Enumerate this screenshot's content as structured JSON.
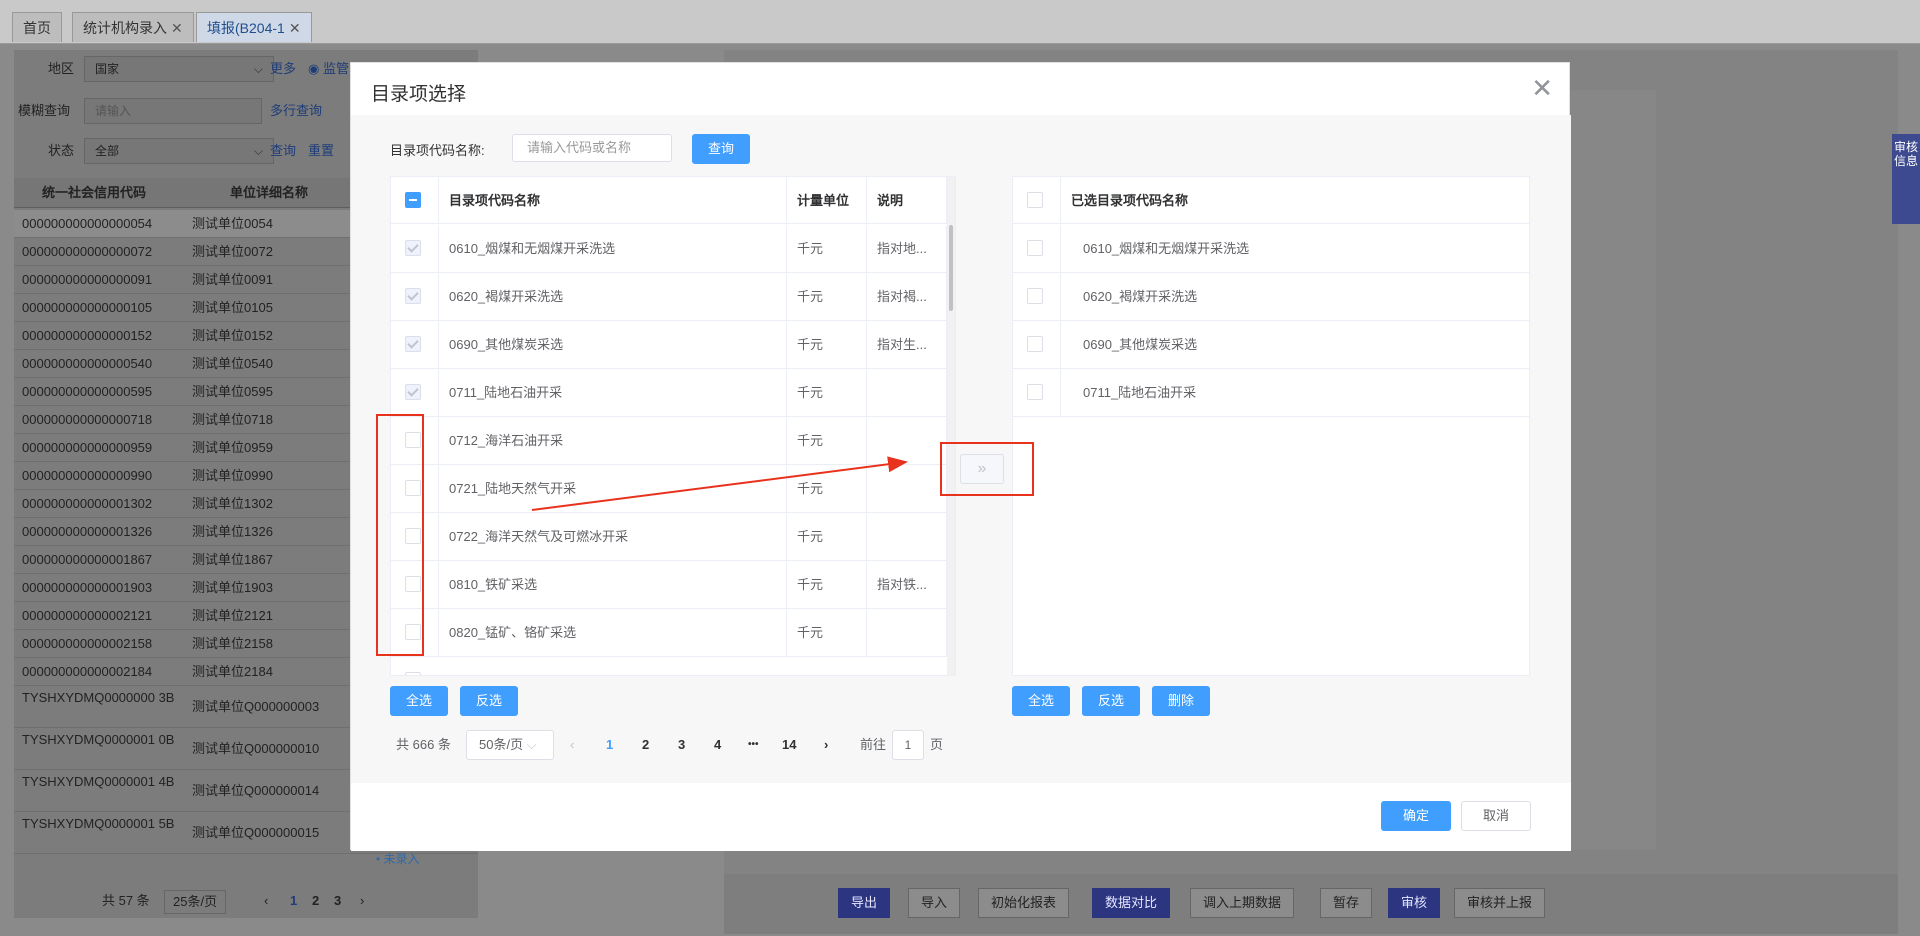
{
  "tabs": [
    {
      "label": "首页",
      "closable": false
    },
    {
      "label": "统计机构录入",
      "closable": true
    },
    {
      "label": "填报(B204-1",
      "closable": true,
      "active": true
    }
  ],
  "left_panel": {
    "region_label": "地区",
    "region_value": "国家",
    "more_label": "更多",
    "supervise_label": "监管",
    "fuzzy_label": "模糊查询",
    "fuzzy_placeholder": "请输入",
    "multiline_query": "多行查询",
    "status_label": "状态",
    "status_value": "全部",
    "query_link": "查询",
    "reset_link": "重置",
    "columns": [
      "统一社会信用代码",
      "单位详细名称"
    ],
    "rows": [
      {
        "code": "000000000000000054",
        "name": "测试单位0054"
      },
      {
        "code": "000000000000000072",
        "name": "测试单位0072"
      },
      {
        "code": "000000000000000091",
        "name": "测试单位0091"
      },
      {
        "code": "000000000000000105",
        "name": "测试单位0105"
      },
      {
        "code": "000000000000000152",
        "name": "测试单位0152"
      },
      {
        "code": "000000000000000540",
        "name": "测试单位0540"
      },
      {
        "code": "000000000000000595",
        "name": "测试单位0595"
      },
      {
        "code": "000000000000000718",
        "name": "测试单位0718"
      },
      {
        "code": "000000000000000959",
        "name": "测试单位0959"
      },
      {
        "code": "000000000000000990",
        "name": "测试单位0990"
      },
      {
        "code": "000000000000001302",
        "name": "测试单位1302"
      },
      {
        "code": "000000000000001326",
        "name": "测试单位1326"
      },
      {
        "code": "000000000000001867",
        "name": "测试单位1867"
      },
      {
        "code": "000000000000001903",
        "name": "测试单位1903"
      },
      {
        "code": "000000000000002121",
        "name": "测试单位2121"
      },
      {
        "code": "000000000000002158",
        "name": "测试单位2158"
      },
      {
        "code": "000000000000002184",
        "name": "测试单位2184"
      }
    ],
    "tall_rows": [
      {
        "code": "TYSHXYDMQ0000000 3B",
        "name": "测试单位Q000000003"
      },
      {
        "code": "TYSHXYDMQ0000001 0B",
        "name": "测试单位Q000000010"
      },
      {
        "code": "TYSHXYDMQ0000001 4B",
        "name": "测试单位Q000000014"
      },
      {
        "code": "TYSHXYDMQ0000001 5B",
        "name": "测试单位Q000000015"
      }
    ],
    "status_unentered": "• 未录入",
    "total": "共 57 条",
    "page_size": "25条/页",
    "pages": [
      "1",
      "2",
      "3"
    ]
  },
  "right_panel": {
    "sidetab": "审核信息",
    "bottom_buttons": [
      {
        "label": "导出",
        "primary": true
      },
      {
        "label": "导入",
        "primary": false
      },
      {
        "label": "初始化报表",
        "primary": false
      },
      {
        "label": "数据对比",
        "primary": true
      },
      {
        "label": "调入上期数据",
        "primary": false
      },
      {
        "label": "暂存",
        "primary": false
      },
      {
        "label": "审核",
        "primary": true
      },
      {
        "label": "审核并上报",
        "primary": false
      }
    ]
  },
  "modal": {
    "title": "目录项选择",
    "query_label": "目录项代码名称:",
    "query_placeholder": "请输入代码或名称",
    "query_button": "查询",
    "left_table": {
      "headers": [
        "目录项代码名称",
        "计量单位",
        "说明"
      ],
      "rows": [
        {
          "name": "0610_烟煤和无烟煤开采洗选",
          "unit": "千元",
          "note": "指对地...",
          "state": "disabled"
        },
        {
          "name": "0620_褐煤开采洗选",
          "unit": "千元",
          "note": "指对褐...",
          "state": "disabled"
        },
        {
          "name": "0690_其他煤炭采选",
          "unit": "千元",
          "note": "指对生...",
          "state": "disabled"
        },
        {
          "name": "0711_陆地石油开采",
          "unit": "千元",
          "note": "",
          "state": "disabled"
        },
        {
          "name": "0712_海洋石油开采",
          "unit": "千元",
          "note": "",
          "state": "unchecked"
        },
        {
          "name": "0721_陆地天然气开采",
          "unit": "千元",
          "note": "",
          "state": "unchecked"
        },
        {
          "name": "0722_海洋天然气及可燃冰开采",
          "unit": "千元",
          "note": "",
          "state": "unchecked"
        },
        {
          "name": "0810_铁矿采选",
          "unit": "千元",
          "note": "指对铁...",
          "state": "unchecked"
        },
        {
          "name": "0820_锰矿、铬矿采选",
          "unit": "千元",
          "note": "",
          "state": "unchecked"
        }
      ],
      "select_all": "全选",
      "invert": "反选"
    },
    "right_table": {
      "header": "已选目录项代码名称",
      "rows": [
        "0610_烟煤和无烟煤开采洗选",
        "0620_褐煤开采洗选",
        "0690_其他煤炭采选",
        "0711_陆地石油开采"
      ],
      "select_all": "全选",
      "invert": "反选",
      "delete": "删除"
    },
    "transfer_icon": "»",
    "pager": {
      "total": "共 666 条",
      "page_size": "50条/页",
      "pages": [
        "1",
        "2",
        "3",
        "4",
        "•••",
        "14"
      ],
      "goto_prefix": "前往",
      "goto_value": "1",
      "goto_suffix": "页"
    },
    "confirm": "确定",
    "cancel": "取消"
  },
  "colors": {
    "primary": "#409eff",
    "annotation": "#e8321e"
  }
}
